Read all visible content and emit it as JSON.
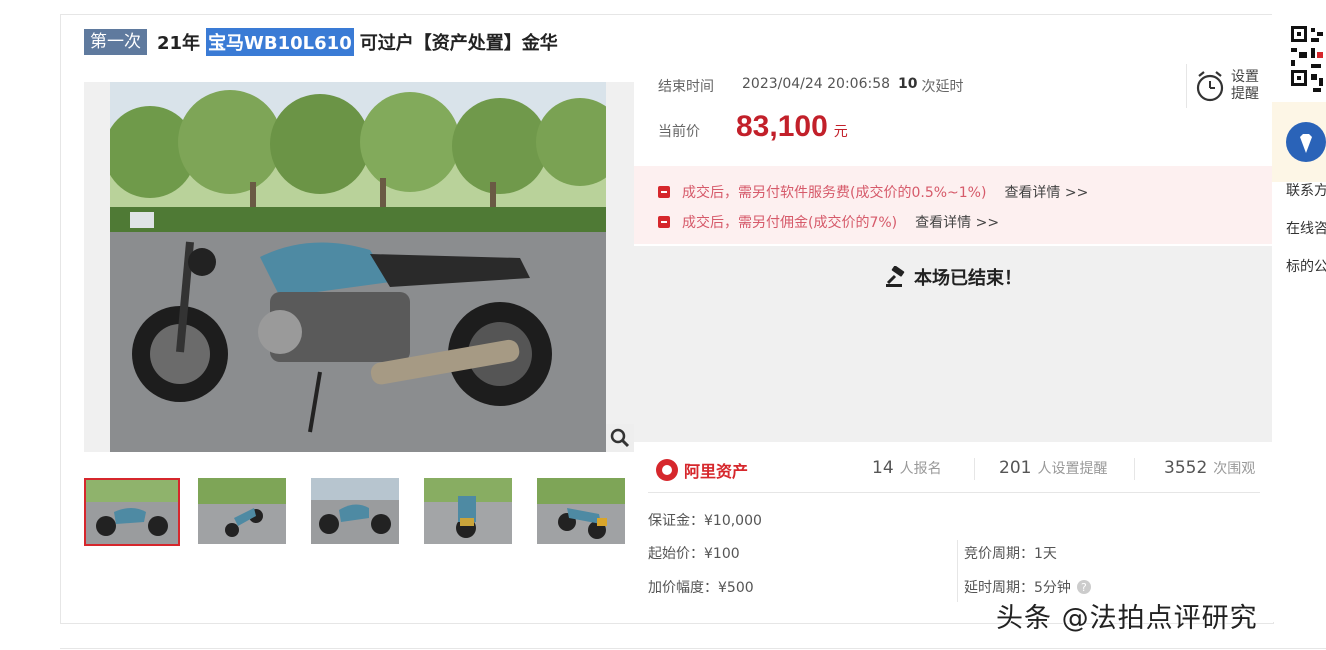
{
  "title": {
    "round_badge": "第一次",
    "prefix": "21年",
    "highlight": "宝马WB10L610",
    "suffix": "可过户【资产处置】金华"
  },
  "auction": {
    "end_time_label": "结束时间",
    "end_time_value": "2023/04/24 20:06:58",
    "delay_count": "10",
    "delay_label": "次延时",
    "current_price_label": "当前价",
    "current_price": "83,100",
    "currency_unit": "元",
    "remind_label": "设置提醒"
  },
  "fees": [
    {
      "text": "成交后，需另付软件服务费(成交价的0.5%~1%)",
      "link": "查看详情 >>"
    },
    {
      "text": "成交后，需另付佣金(成交价的7%)",
      "link": "查看详情 >>"
    }
  ],
  "status": {
    "ended_text": "本场已结束！"
  },
  "platform": {
    "logo_text": "阿里资产"
  },
  "stats": [
    {
      "value": "14",
      "label": "人报名"
    },
    {
      "value": "201",
      "label": "人设置提醒"
    },
    {
      "value": "3552",
      "label": "次围观"
    }
  ],
  "details": {
    "deposit": "保证金：¥10,000",
    "start_price": "起始价：¥100",
    "increment": "加价幅度：¥500",
    "bid_cycle": "竞价周期：1天",
    "delay_cycle": "延时周期：5分钟"
  },
  "sidebar": {
    "items": [
      "联系方",
      "在线咨",
      "标的公"
    ]
  },
  "watermark": "头条 @法拍点评研究",
  "colors": {
    "price_red": "#c2202a",
    "badge_blue": "#5f7a9e",
    "highlight_blue": "#3a7bd5",
    "fee_bg": "#fdf0f0",
    "moto_blue": "#4e8aa3"
  },
  "thumbnails_count": 5
}
